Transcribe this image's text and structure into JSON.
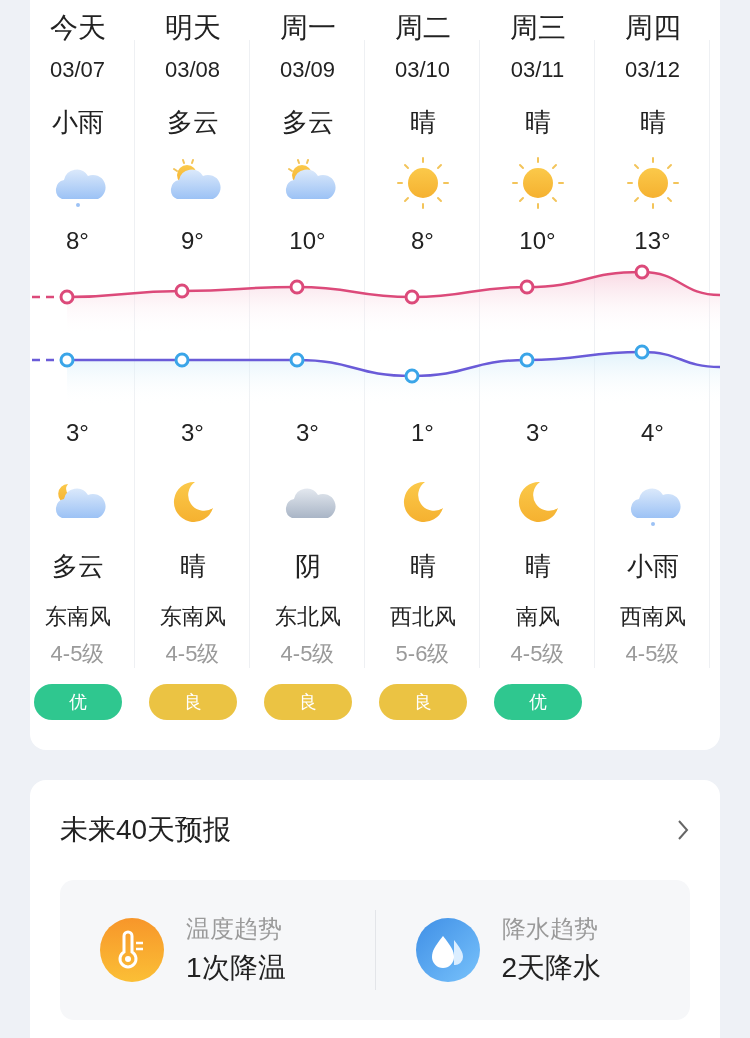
{
  "days": [
    {
      "day": "今天",
      "date": "03/07",
      "day_weather": "小雨",
      "day_icon": {
        "kind": "rain"
      },
      "high": "8°",
      "low": "3°",
      "night_icon": {
        "kind": "partly_cloudy_night"
      },
      "night_weather": "多云",
      "wind": "东南风",
      "wind_level": "4-5级",
      "aqi": {
        "label": "优",
        "color": "#2fc78f"
      }
    },
    {
      "day": "明天",
      "date": "03/08",
      "day_weather": "多云",
      "day_icon": {
        "kind": "partly_cloudy_day"
      },
      "high": "9°",
      "low": "3°",
      "night_icon": {
        "kind": "moon"
      },
      "night_weather": "晴",
      "wind": "东南风",
      "wind_level": "4-5级",
      "aqi": {
        "label": "良",
        "color": "#ebc343"
      }
    },
    {
      "day": "周一",
      "date": "03/09",
      "day_weather": "多云",
      "day_icon": {
        "kind": "partly_cloudy_day"
      },
      "high": "10°",
      "low": "3°",
      "night_icon": {
        "kind": "overcast"
      },
      "night_weather": "阴",
      "wind": "东北风",
      "wind_level": "4-5级",
      "aqi": {
        "label": "良",
        "color": "#ebc343"
      }
    },
    {
      "day": "周二",
      "date": "03/10",
      "day_weather": "晴",
      "day_icon": {
        "kind": "sun"
      },
      "high": "8°",
      "low": "1°",
      "night_icon": {
        "kind": "moon"
      },
      "night_weather": "晴",
      "wind": "西北风",
      "wind_level": "5-6级",
      "aqi": {
        "label": "良",
        "color": "#ebc343"
      }
    },
    {
      "day": "周三",
      "date": "03/11",
      "day_weather": "晴",
      "day_icon": {
        "kind": "sun"
      },
      "high": "10°",
      "low": "3°",
      "night_icon": {
        "kind": "moon"
      },
      "night_weather": "晴",
      "wind": "南风",
      "wind_level": "4-5级",
      "aqi": {
        "label": "优",
        "color": "#2fc78f"
      }
    },
    {
      "day": "周四",
      "date": "03/12",
      "day_weather": "晴",
      "day_icon": {
        "kind": "sun"
      },
      "high": "13°",
      "low": "4°",
      "night_icon": {
        "kind": "rain"
      },
      "night_weather": "小雨",
      "wind": "西南风",
      "wind_level": "4-5级"
    }
  ],
  "forecast40": {
    "title": "未来40天预报",
    "items": [
      {
        "kind": "temperature",
        "label": "温度趋势",
        "value": "1次降温"
      },
      {
        "kind": "precipitation",
        "label": "降水趋势",
        "value": "2天降水"
      }
    ]
  }
}
